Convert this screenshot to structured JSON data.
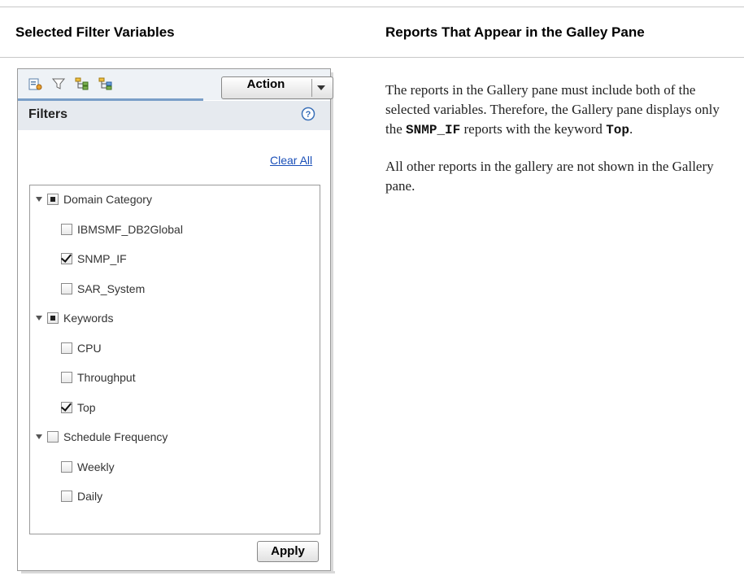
{
  "headers": {
    "left": "Selected Filter Variables",
    "right": "Reports That Appear in the Galley Pane"
  },
  "panel": {
    "toolbar_icons": [
      "report-list-icon",
      "filter-icon",
      "tree-view-icon",
      "hierarchy-icon"
    ],
    "action_label": "Action",
    "filters_title": "Filters",
    "clear_all": "Clear All",
    "apply": "Apply",
    "tree": [
      {
        "label": "Domain Category",
        "state": "partial",
        "level": 0
      },
      {
        "label": "IBMSMF_DB2Global",
        "state": "unchecked",
        "level": 1
      },
      {
        "label": "SNMP_IF",
        "state": "checked",
        "level": 1
      },
      {
        "label": "SAR_System",
        "state": "unchecked",
        "level": 1
      },
      {
        "label": "Keywords",
        "state": "partial",
        "level": 0
      },
      {
        "label": "CPU",
        "state": "unchecked",
        "level": 1
      },
      {
        "label": "Throughput",
        "state": "unchecked",
        "level": 1
      },
      {
        "label": "Top",
        "state": "checked",
        "level": 1
      },
      {
        "label": "Schedule Frequency",
        "state": "unchecked",
        "level": 0
      },
      {
        "label": "Weekly",
        "state": "unchecked",
        "level": 1
      },
      {
        "label": "Daily",
        "state": "unchecked",
        "level": 1
      }
    ]
  },
  "description": {
    "p1_before": "The reports in the Gallery pane must include both of the selected variables. Therefore, the Gallery pane displays only the ",
    "p1_code1": "SNMP_IF",
    "p1_middle": " reports with the keyword ",
    "p1_code2": "Top",
    "p1_end": ".",
    "p2": "All other reports in the gallery are not shown in the Gallery pane."
  },
  "colors": {
    "toolbar_bg": "#eef2f6",
    "filters_bar_bg": "#e6eaef",
    "link": "#1a4fb8",
    "tab_accent": "#7a9fc8"
  }
}
